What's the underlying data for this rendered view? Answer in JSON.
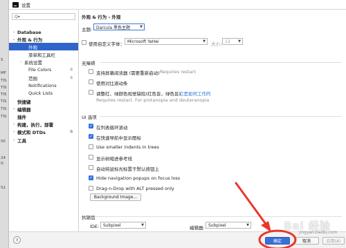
{
  "window": {
    "title": "设置"
  },
  "left_strip": {
    "labels": [
      "S",
      "MF",
      "TIS",
      "TIS",
      "TIS",
      "TIS",
      "TIS",
      "TIS",
      "S5",
      "24",
      "0:",
      "S1"
    ]
  },
  "sidebar": {
    "search_placeholder": "Q▾",
    "items": [
      {
        "label": "Database",
        "arrow": "›",
        "bold": true
      },
      {
        "label": "外观 & 行为",
        "arrow": "⌄",
        "bold": true
      },
      {
        "label": "外观",
        "arrow": "",
        "selected": true
      },
      {
        "label": "菜单和工具栏",
        "arrow": ""
      },
      {
        "label": "系统设置",
        "arrow": "›"
      },
      {
        "label": "File Colors",
        "arrow": "",
        "icon": "copy-icon"
      },
      {
        "label": "范围",
        "arrow": "",
        "icon": "copy-icon"
      },
      {
        "label": "Notifications",
        "arrow": ""
      },
      {
        "label": "Quick Lists",
        "arrow": ""
      },
      {
        "label": "快捷键",
        "arrow": "",
        "bold": true
      },
      {
        "label": "编辑器",
        "arrow": "›",
        "bold": true
      },
      {
        "label": "插件",
        "arrow": "",
        "bold": true
      },
      {
        "label": "构建，执行，部署",
        "arrow": "›",
        "bold": true
      },
      {
        "label": "模式和 DTDs",
        "arrow": "›",
        "bold": true,
        "icon": "copy-icon"
      },
      {
        "label": "工具",
        "arrow": "›",
        "bold": true
      }
    ]
  },
  "main": {
    "breadcrumb": "外观 & 行为  ›  外观",
    "theme": {
      "label": "主题:",
      "value": "Darcula 黑色主题"
    },
    "custom_font": {
      "label": "使用自定义字体：",
      "font_value": "Microsoft YaHei",
      "size_label": "大小：",
      "size_value": "12"
    },
    "accessibility": {
      "title": "无障碍",
      "items": [
        {
          "label": "支持屏幕阅读器 (需要重新启动)",
          "hint": "Requires restart",
          "checked": false
        },
        {
          "label": "使用对比滚动条",
          "checked": false
        },
        {
          "label": "调整红、绿颜色视觉缺陷(红色盲，绿色盲)",
          "link": "它是如何工作的",
          "checked": false
        }
      ],
      "hint2": "Requires restart. For protanopia and deuteranopia"
    },
    "ui_options": {
      "title": "UI 选项",
      "items": [
        {
          "label": "在列表循环滚动",
          "checked": true
        },
        {
          "label": "在快速导航中显示图标",
          "checked": true
        },
        {
          "label": "Use smaller indents in trees",
          "checked": false
        },
        {
          "label": "显示树缩进参考线",
          "checked": false
        },
        {
          "label": "自动将鼠标光标置于默认按钮上",
          "checked": false
        },
        {
          "label": "Hide navigation popups on focus loss",
          "checked": true
        },
        {
          "label": "Drag-n-Drop with ALT pressed only",
          "checked": false
        }
      ],
      "bg_button": "Background Image..."
    },
    "antialias": {
      "title": "抗锯齿",
      "ide_label": "IDE:",
      "ide_value": "Subpixel",
      "editor_label": "编辑器:",
      "editor_value": "Subpixel"
    }
  },
  "footer": {
    "help": "?",
    "ok": "确定",
    "cancel": "取消",
    "apply": "应用(A)"
  },
  "watermark": {
    "main": "Bai 经验",
    "sub": "jingyan.baidu.com"
  },
  "colors": {
    "accent": "#2f65ca",
    "arrow": "#e8372c",
    "check": "#3574e0"
  }
}
